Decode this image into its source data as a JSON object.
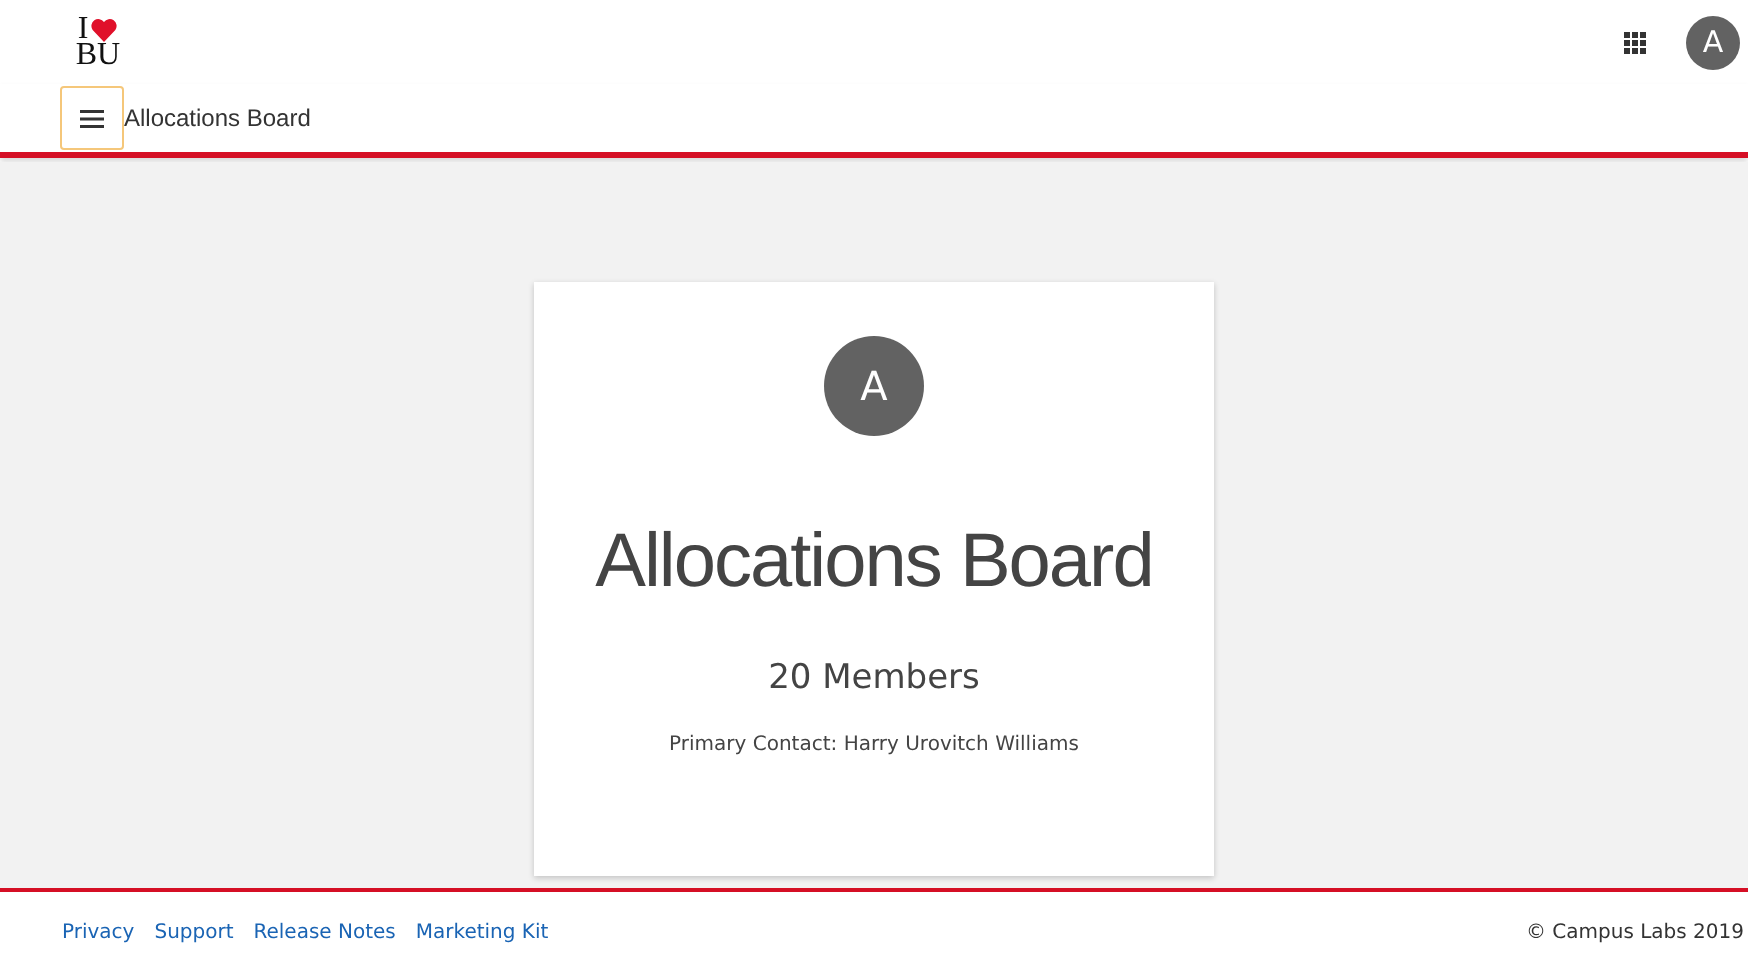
{
  "header": {
    "logo": {
      "top": "I",
      "bottom": "BU"
    },
    "user_initial": "A"
  },
  "toolbar": {
    "title": "Allocations Board"
  },
  "card": {
    "initial": "A",
    "name": "Allocations Board",
    "members": "20 Members",
    "contact": "Primary Contact: Harry Urovitch Williams"
  },
  "footer": {
    "links": [
      "Privacy",
      "Support",
      "Release Notes",
      "Marketing Kit"
    ],
    "copyright": "© Campus Labs 2019"
  }
}
